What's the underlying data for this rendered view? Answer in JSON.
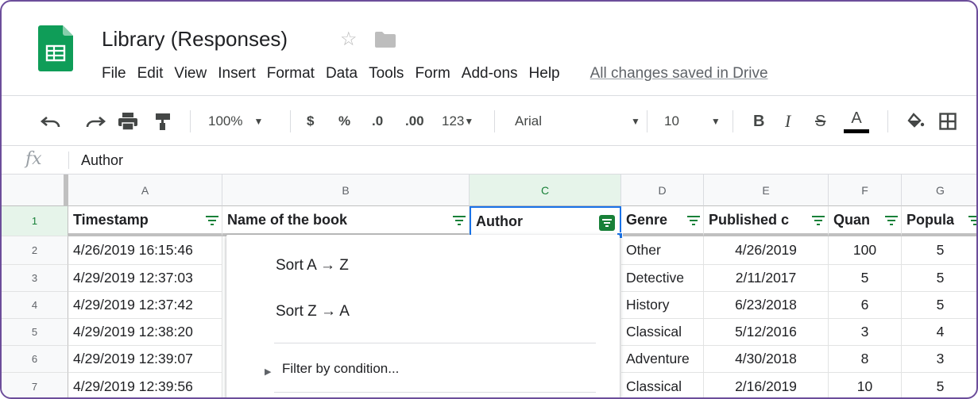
{
  "header": {
    "title": "Library (Responses)",
    "star_icon": "star-outline-icon",
    "folder_icon": "folder-icon",
    "menu": [
      "File",
      "Edit",
      "View",
      "Insert",
      "Format",
      "Data",
      "Tools",
      "Form",
      "Add-ons",
      "Help"
    ],
    "save_status": "All changes saved in Drive"
  },
  "toolbar": {
    "zoom": "100%",
    "currency": "$",
    "percent": "%",
    "decrease_decimal": ".0",
    "increase_decimal": ".00",
    "more_formats": "123",
    "font": "Arial",
    "font_size": "10",
    "bold": "B",
    "italic": "I",
    "strikethrough": "S",
    "text_color": "A"
  },
  "formula_bar": {
    "fx": "fx",
    "value": "Author"
  },
  "grid": {
    "columns": [
      "A",
      "B",
      "C",
      "D",
      "E",
      "F",
      "G"
    ],
    "row_numbers": [
      "1",
      "2",
      "3",
      "4",
      "5",
      "6",
      "7"
    ],
    "header_row": [
      "Timestamp",
      "Name of the book",
      "Author",
      "Genre",
      "Published c",
      "Quan",
      "Popula"
    ],
    "rows": [
      [
        "4/26/2019 16:15:46",
        "Other",
        "4/26/2019",
        "100",
        "5"
      ],
      [
        "4/29/2019 12:37:03",
        "Detective",
        "2/11/2017",
        "5",
        "5"
      ],
      [
        "4/29/2019 12:37:42",
        "History",
        "6/23/2018",
        "6",
        "5"
      ],
      [
        "4/29/2019 12:38:20",
        "Classical",
        "5/12/2016",
        "3",
        "4"
      ],
      [
        "4/29/2019 12:39:07",
        "Adventure",
        "4/30/2018",
        "8",
        "3"
      ],
      [
        "4/29/2019 12:39:56",
        "Classical",
        "2/16/2019",
        "10",
        "5"
      ]
    ]
  },
  "filter_menu": {
    "sort_asc": "Sort A → Z",
    "sort_desc": "Sort Z → A",
    "filter_by_condition": "Filter by condition..."
  },
  "colors": {
    "sheets_green": "#0f9d58",
    "selected_header": "#e6f4ea",
    "selection_blue": "#1a73e8",
    "active_filter": "#188038"
  }
}
